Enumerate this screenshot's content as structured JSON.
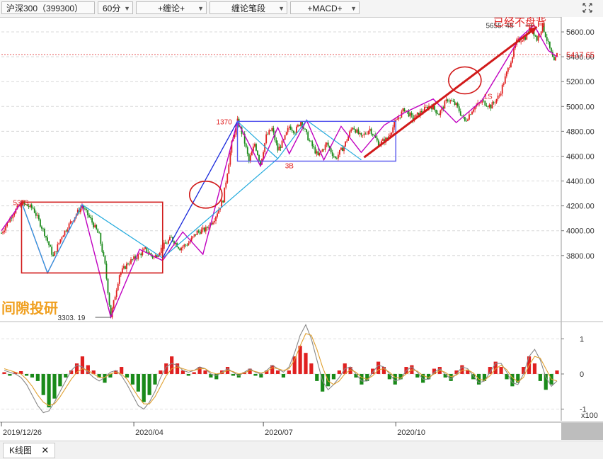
{
  "toolbar": {
    "symbol": "沪深300（399300）",
    "period": "60分",
    "indicator1": "+缠论+",
    "indicator2": "缠论笔段",
    "indicator3": "+MACD+",
    "maximize_icon": "maximize-icon"
  },
  "annotations": {
    "headline": "已经不盘背",
    "watermark": "间隙投研",
    "seg_label_1370": "1370",
    "seg_label_3b": "3B",
    "seg_label_1s": "1S",
    "seg_label_left_1s": "1S",
    "low_label": "3303. 19",
    "high_label": "5655. 48",
    "left_high_label": "537"
  },
  "colors": {
    "up": "#e02020",
    "down": "#1a8a1a",
    "bi_line": "#c000c0",
    "segment_line": "#2222dd",
    "segment_line2": "#22aadd",
    "box_red": "#d11a1a",
    "box_blue": "#5555ee",
    "price_tag": "#e02020",
    "dif": "#888888",
    "dea": "#e0a030"
  },
  "chart_data": [
    {
      "type": "candlestick",
      "title": "沪深300（399300）",
      "interval": "60分",
      "y_ticks": [
        "5600.00",
        "5400.00",
        "5200.00",
        "5000.00",
        "4800.00",
        "4600.00",
        "4400.00",
        "4200.00",
        "4000.00",
        "3800.00"
      ],
      "x_ticks": [
        "2019/12/26",
        "2020/04",
        "2020/07",
        "2020/10"
      ],
      "ylim": [
        3280,
        5720
      ],
      "last_price": "5417.65",
      "grid": "dashed horizontal",
      "price_path": [
        {
          "t": 0,
          "v": 3980
        },
        {
          "t": 4,
          "v": 4140
        },
        {
          "t": 7,
          "v": 4220
        },
        {
          "t": 11,
          "v": 4180
        },
        {
          "t": 15,
          "v": 3980
        },
        {
          "t": 18,
          "v": 3790
        },
        {
          "t": 21,
          "v": 3960
        },
        {
          "t": 25,
          "v": 4100
        },
        {
          "t": 28,
          "v": 4200
        },
        {
          "t": 31,
          "v": 4090
        },
        {
          "t": 34,
          "v": 3960
        },
        {
          "t": 36,
          "v": 3720
        },
        {
          "t": 38,
          "v": 3310
        },
        {
          "t": 41,
          "v": 3650
        },
        {
          "t": 44,
          "v": 3740
        },
        {
          "t": 47,
          "v": 3790
        },
        {
          "t": 50,
          "v": 3850
        },
        {
          "t": 53,
          "v": 3780
        },
        {
          "t": 56,
          "v": 3870
        },
        {
          "t": 59,
          "v": 3940
        },
        {
          "t": 62,
          "v": 3860
        },
        {
          "t": 65,
          "v": 3900
        },
        {
          "t": 68,
          "v": 3990
        },
        {
          "t": 71,
          "v": 4010
        },
        {
          "t": 74,
          "v": 4100
        },
        {
          "t": 77,
          "v": 4250
        },
        {
          "t": 80,
          "v": 4700
        },
        {
          "t": 82,
          "v": 4880
        },
        {
          "t": 84,
          "v": 4760
        },
        {
          "t": 86,
          "v": 4560
        },
        {
          "t": 88,
          "v": 4700
        },
        {
          "t": 90,
          "v": 4540
        },
        {
          "t": 92,
          "v": 4760
        },
        {
          "t": 94,
          "v": 4820
        },
        {
          "t": 96,
          "v": 4650
        },
        {
          "t": 98,
          "v": 4720
        },
        {
          "t": 100,
          "v": 4840
        },
        {
          "t": 102,
          "v": 4800
        },
        {
          "t": 104,
          "v": 4880
        },
        {
          "t": 107,
          "v": 4720
        },
        {
          "t": 110,
          "v": 4600
        },
        {
          "t": 113,
          "v": 4700
        },
        {
          "t": 116,
          "v": 4580
        },
        {
          "t": 119,
          "v": 4680
        },
        {
          "t": 122,
          "v": 4840
        },
        {
          "t": 125,
          "v": 4750
        },
        {
          "t": 128,
          "v": 4820
        },
        {
          "t": 131,
          "v": 4700
        },
        {
          "t": 134,
          "v": 4740
        },
        {
          "t": 137,
          "v": 4880
        },
        {
          "t": 140,
          "v": 4980
        },
        {
          "t": 143,
          "v": 4900
        },
        {
          "t": 146,
          "v": 4960
        },
        {
          "t": 149,
          "v": 5010
        },
        {
          "t": 152,
          "v": 4940
        },
        {
          "t": 155,
          "v": 5060
        },
        {
          "t": 158,
          "v": 5010
        },
        {
          "t": 161,
          "v": 4880
        },
        {
          "t": 164,
          "v": 4990
        },
        {
          "t": 167,
          "v": 5040
        },
        {
          "t": 170,
          "v": 5000
        },
        {
          "t": 173,
          "v": 5090
        },
        {
          "t": 176,
          "v": 5300
        },
        {
          "t": 179,
          "v": 5520
        },
        {
          "t": 182,
          "v": 5560
        },
        {
          "t": 184,
          "v": 5640
        },
        {
          "t": 186,
          "v": 5540
        },
        {
          "t": 188,
          "v": 5650
        },
        {
          "t": 190,
          "v": 5500
        },
        {
          "t": 192,
          "v": 5350
        },
        {
          "t": 193,
          "v": 5417
        }
      ],
      "bi_points": [
        {
          "t": 0,
          "v": 4000
        },
        {
          "t": 7,
          "v": 4230
        },
        {
          "t": 16,
          "v": 3660
        },
        {
          "t": 28,
          "v": 4210
        },
        {
          "t": 38,
          "v": 3303
        },
        {
          "t": 48,
          "v": 3850
        },
        {
          "t": 56,
          "v": 3760
        },
        {
          "t": 63,
          "v": 3990
        },
        {
          "t": 70,
          "v": 3810
        },
        {
          "t": 82,
          "v": 4880
        },
        {
          "t": 90,
          "v": 4520
        },
        {
          "t": 96,
          "v": 4830
        },
        {
          "t": 100,
          "v": 4620
        },
        {
          "t": 106,
          "v": 4890
        },
        {
          "t": 112,
          "v": 4570
        },
        {
          "t": 118,
          "v": 4840
        },
        {
          "t": 125,
          "v": 4630
        },
        {
          "t": 133,
          "v": 4850
        },
        {
          "t": 140,
          "v": 4950
        },
        {
          "t": 150,
          "v": 5060
        },
        {
          "t": 158,
          "v": 4870
        },
        {
          "t": 167,
          "v": 5050
        },
        {
          "t": 180,
          "v": 5550
        },
        {
          "t": 185,
          "v": 5655
        },
        {
          "t": 190,
          "v": 5450
        },
        {
          "t": 193,
          "v": 5400
        }
      ],
      "segment_points": [
        {
          "t": 7,
          "v": 4230
        },
        {
          "t": 16,
          "v": 3660
        },
        {
          "t": 28,
          "v": 4210
        },
        {
          "t": 56,
          "v": 3780
        },
        {
          "t": 82,
          "v": 4880
        },
        {
          "t": 96,
          "v": 4580
        },
        {
          "t": 106,
          "v": 4890
        },
        {
          "t": 125,
          "v": 4570
        }
      ],
      "segment2_points": [
        {
          "t": 56,
          "v": 3780
        },
        {
          "t": 96,
          "v": 4580
        }
      ],
      "red_box": {
        "t0": 7,
        "t1": 56,
        "v0": 3660,
        "v1": 4230
      },
      "blue_box": {
        "t0": 82,
        "t1": 137,
        "v0": 4560,
        "v1": 4880
      },
      "arrow": {
        "t0": 126,
        "v0": 4590,
        "t1": 186,
        "v1": 5640
      },
      "circles": [
        {
          "t": 71,
          "v": 4290
        },
        {
          "t": 161,
          "v": 5210
        }
      ]
    },
    {
      "type": "bar",
      "title": "MACD",
      "y_ticks": [
        "1",
        "0",
        "-1"
      ],
      "unit_label": "x100",
      "ylim": [
        -1.25,
        1.45
      ],
      "histogram": [
        0.05,
        -0.05,
        0.05,
        0.08,
        -0.05,
        -0.1,
        -0.2,
        -0.6,
        -0.95,
        -0.7,
        -0.35,
        -0.1,
        0.1,
        0.3,
        0.5,
        0.25,
        0.1,
        -0.1,
        -0.25,
        -0.1,
        0.1,
        0.2,
        -0.1,
        -0.3,
        -0.5,
        -0.8,
        -0.6,
        -0.3,
        0.1,
        0.3,
        0.5,
        0.3,
        0.1,
        -0.05,
        0.05,
        0.2,
        0.1,
        -0.1,
        -0.15,
        0.1,
        0.2,
        -0.05,
        -0.1,
        0.05,
        0.15,
        -0.05,
        -0.1,
        0.1,
        0.25,
        0.1,
        -0.1,
        0.1,
        0.5,
        0.8,
        0.6,
        0.3,
        -0.2,
        -0.5,
        -0.35,
        -0.15,
        0.1,
        0.3,
        0.2,
        -0.1,
        -0.3,
        -0.2,
        0.15,
        0.35,
        0.2,
        -0.15,
        -0.3,
        -0.15,
        0.2,
        0.25,
        -0.1,
        -0.25,
        -0.15,
        0.15,
        0.2,
        -0.1,
        -0.2,
        0.1,
        0.25,
        0.1,
        -0.15,
        -0.3,
        -0.2,
        0.2,
        0.35,
        0.2,
        -0.15,
        -0.35,
        -0.25,
        0.2,
        0.5,
        0.3,
        -0.2,
        -0.45,
        -0.3,
        0.1
      ],
      "dif": [
        0.1,
        0.05,
        0.0,
        -0.1,
        -0.3,
        -0.6,
        -0.9,
        -1.1,
        -1.05,
        -0.8,
        -0.5,
        -0.2,
        0.1,
        0.25,
        0.2,
        0.05,
        -0.1,
        -0.2,
        -0.1,
        0.05,
        0.1,
        -0.05,
        -0.3,
        -0.6,
        -0.9,
        -1.0,
        -0.8,
        -0.5,
        -0.1,
        0.2,
        0.3,
        0.25,
        0.1,
        0.05,
        0.1,
        0.2,
        0.15,
        0.0,
        -0.05,
        0.05,
        0.15,
        0.05,
        -0.05,
        0.05,
        0.15,
        0.05,
        0.0,
        0.1,
        0.25,
        0.15,
        0.05,
        0.2,
        0.6,
        1.1,
        1.4,
        1.0,
        0.4,
        -0.2,
        -0.45,
        -0.3,
        -0.1,
        0.15,
        0.2,
        0.0,
        -0.2,
        -0.2,
        0.05,
        0.25,
        0.2,
        0.0,
        -0.2,
        -0.15,
        0.1,
        0.2,
        0.05,
        -0.15,
        -0.15,
        0.05,
        0.15,
        0.0,
        -0.15,
        0.0,
        0.2,
        0.15,
        -0.05,
        -0.25,
        -0.2,
        0.05,
        0.3,
        0.3,
        0.05,
        -0.25,
        -0.3,
        0.0,
        0.5,
        0.7,
        0.4,
        -0.1,
        -0.35,
        -0.2
      ],
      "dea": [
        0.15,
        0.1,
        0.05,
        0.0,
        -0.15,
        -0.35,
        -0.6,
        -0.8,
        -0.9,
        -0.85,
        -0.65,
        -0.4,
        -0.15,
        0.05,
        0.15,
        0.1,
        0.0,
        -0.1,
        -0.1,
        0.0,
        0.05,
        0.0,
        -0.15,
        -0.4,
        -0.65,
        -0.85,
        -0.85,
        -0.65,
        -0.35,
        -0.05,
        0.15,
        0.2,
        0.15,
        0.1,
        0.1,
        0.15,
        0.15,
        0.05,
        0.0,
        0.03,
        0.1,
        0.07,
        0.0,
        0.03,
        0.1,
        0.07,
        0.03,
        0.07,
        0.18,
        0.15,
        0.1,
        0.15,
        0.4,
        0.8,
        1.15,
        1.1,
        0.7,
        0.2,
        -0.2,
        -0.3,
        -0.2,
        0.0,
        0.12,
        0.05,
        -0.1,
        -0.15,
        -0.05,
        0.12,
        0.15,
        0.05,
        -0.1,
        -0.12,
        0.0,
        0.12,
        0.08,
        -0.05,
        -0.1,
        0.0,
        0.1,
        0.05,
        -0.08,
        -0.03,
        0.1,
        0.12,
        0.03,
        -0.15,
        -0.18,
        -0.05,
        0.15,
        0.25,
        0.12,
        -0.1,
        -0.22,
        -0.1,
        0.25,
        0.5,
        0.45,
        0.15,
        -0.15,
        -0.2
      ]
    }
  ],
  "x_labels": {
    "t0": "2019/12/26",
    "t1": "2020/04",
    "t2": "2020/07",
    "t3": "2020/10"
  },
  "tab": {
    "label": "K线图",
    "close": "✕"
  }
}
